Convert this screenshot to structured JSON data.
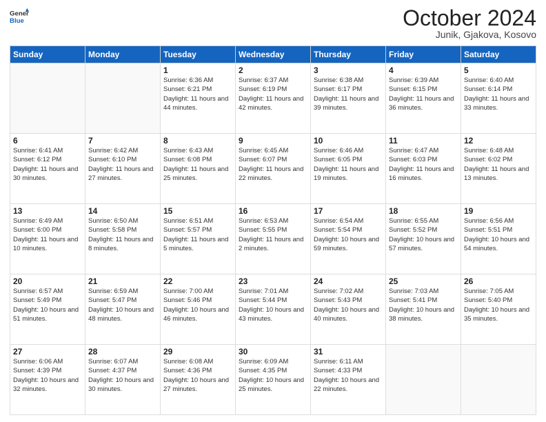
{
  "header": {
    "logo_general": "General",
    "logo_blue": "Blue",
    "title": "October 2024",
    "subtitle": "Junik, Gjakova, Kosovo"
  },
  "days_of_week": [
    "Sunday",
    "Monday",
    "Tuesday",
    "Wednesday",
    "Thursday",
    "Friday",
    "Saturday"
  ],
  "weeks": [
    [
      {
        "day": "",
        "sunrise": "",
        "sunset": "",
        "daylight": ""
      },
      {
        "day": "",
        "sunrise": "",
        "sunset": "",
        "daylight": ""
      },
      {
        "day": "1",
        "sunrise": "Sunrise: 6:36 AM",
        "sunset": "Sunset: 6:21 PM",
        "daylight": "Daylight: 11 hours and 44 minutes."
      },
      {
        "day": "2",
        "sunrise": "Sunrise: 6:37 AM",
        "sunset": "Sunset: 6:19 PM",
        "daylight": "Daylight: 11 hours and 42 minutes."
      },
      {
        "day": "3",
        "sunrise": "Sunrise: 6:38 AM",
        "sunset": "Sunset: 6:17 PM",
        "daylight": "Daylight: 11 hours and 39 minutes."
      },
      {
        "day": "4",
        "sunrise": "Sunrise: 6:39 AM",
        "sunset": "Sunset: 6:15 PM",
        "daylight": "Daylight: 11 hours and 36 minutes."
      },
      {
        "day": "5",
        "sunrise": "Sunrise: 6:40 AM",
        "sunset": "Sunset: 6:14 PM",
        "daylight": "Daylight: 11 hours and 33 minutes."
      }
    ],
    [
      {
        "day": "6",
        "sunrise": "Sunrise: 6:41 AM",
        "sunset": "Sunset: 6:12 PM",
        "daylight": "Daylight: 11 hours and 30 minutes."
      },
      {
        "day": "7",
        "sunrise": "Sunrise: 6:42 AM",
        "sunset": "Sunset: 6:10 PM",
        "daylight": "Daylight: 11 hours and 27 minutes."
      },
      {
        "day": "8",
        "sunrise": "Sunrise: 6:43 AM",
        "sunset": "Sunset: 6:08 PM",
        "daylight": "Daylight: 11 hours and 25 minutes."
      },
      {
        "day": "9",
        "sunrise": "Sunrise: 6:45 AM",
        "sunset": "Sunset: 6:07 PM",
        "daylight": "Daylight: 11 hours and 22 minutes."
      },
      {
        "day": "10",
        "sunrise": "Sunrise: 6:46 AM",
        "sunset": "Sunset: 6:05 PM",
        "daylight": "Daylight: 11 hours and 19 minutes."
      },
      {
        "day": "11",
        "sunrise": "Sunrise: 6:47 AM",
        "sunset": "Sunset: 6:03 PM",
        "daylight": "Daylight: 11 hours and 16 minutes."
      },
      {
        "day": "12",
        "sunrise": "Sunrise: 6:48 AM",
        "sunset": "Sunset: 6:02 PM",
        "daylight": "Daylight: 11 hours and 13 minutes."
      }
    ],
    [
      {
        "day": "13",
        "sunrise": "Sunrise: 6:49 AM",
        "sunset": "Sunset: 6:00 PM",
        "daylight": "Daylight: 11 hours and 10 minutes."
      },
      {
        "day": "14",
        "sunrise": "Sunrise: 6:50 AM",
        "sunset": "Sunset: 5:58 PM",
        "daylight": "Daylight: 11 hours and 8 minutes."
      },
      {
        "day": "15",
        "sunrise": "Sunrise: 6:51 AM",
        "sunset": "Sunset: 5:57 PM",
        "daylight": "Daylight: 11 hours and 5 minutes."
      },
      {
        "day": "16",
        "sunrise": "Sunrise: 6:53 AM",
        "sunset": "Sunset: 5:55 PM",
        "daylight": "Daylight: 11 hours and 2 minutes."
      },
      {
        "day": "17",
        "sunrise": "Sunrise: 6:54 AM",
        "sunset": "Sunset: 5:54 PM",
        "daylight": "Daylight: 10 hours and 59 minutes."
      },
      {
        "day": "18",
        "sunrise": "Sunrise: 6:55 AM",
        "sunset": "Sunset: 5:52 PM",
        "daylight": "Daylight: 10 hours and 57 minutes."
      },
      {
        "day": "19",
        "sunrise": "Sunrise: 6:56 AM",
        "sunset": "Sunset: 5:51 PM",
        "daylight": "Daylight: 10 hours and 54 minutes."
      }
    ],
    [
      {
        "day": "20",
        "sunrise": "Sunrise: 6:57 AM",
        "sunset": "Sunset: 5:49 PM",
        "daylight": "Daylight: 10 hours and 51 minutes."
      },
      {
        "day": "21",
        "sunrise": "Sunrise: 6:59 AM",
        "sunset": "Sunset: 5:47 PM",
        "daylight": "Daylight: 10 hours and 48 minutes."
      },
      {
        "day": "22",
        "sunrise": "Sunrise: 7:00 AM",
        "sunset": "Sunset: 5:46 PM",
        "daylight": "Daylight: 10 hours and 46 minutes."
      },
      {
        "day": "23",
        "sunrise": "Sunrise: 7:01 AM",
        "sunset": "Sunset: 5:44 PM",
        "daylight": "Daylight: 10 hours and 43 minutes."
      },
      {
        "day": "24",
        "sunrise": "Sunrise: 7:02 AM",
        "sunset": "Sunset: 5:43 PM",
        "daylight": "Daylight: 10 hours and 40 minutes."
      },
      {
        "day": "25",
        "sunrise": "Sunrise: 7:03 AM",
        "sunset": "Sunset: 5:41 PM",
        "daylight": "Daylight: 10 hours and 38 minutes."
      },
      {
        "day": "26",
        "sunrise": "Sunrise: 7:05 AM",
        "sunset": "Sunset: 5:40 PM",
        "daylight": "Daylight: 10 hours and 35 minutes."
      }
    ],
    [
      {
        "day": "27",
        "sunrise": "Sunrise: 6:06 AM",
        "sunset": "Sunset: 4:39 PM",
        "daylight": "Daylight: 10 hours and 32 minutes."
      },
      {
        "day": "28",
        "sunrise": "Sunrise: 6:07 AM",
        "sunset": "Sunset: 4:37 PM",
        "daylight": "Daylight: 10 hours and 30 minutes."
      },
      {
        "day": "29",
        "sunrise": "Sunrise: 6:08 AM",
        "sunset": "Sunset: 4:36 PM",
        "daylight": "Daylight: 10 hours and 27 minutes."
      },
      {
        "day": "30",
        "sunrise": "Sunrise: 6:09 AM",
        "sunset": "Sunset: 4:35 PM",
        "daylight": "Daylight: 10 hours and 25 minutes."
      },
      {
        "day": "31",
        "sunrise": "Sunrise: 6:11 AM",
        "sunset": "Sunset: 4:33 PM",
        "daylight": "Daylight: 10 hours and 22 minutes."
      },
      {
        "day": "",
        "sunrise": "",
        "sunset": "",
        "daylight": ""
      },
      {
        "day": "",
        "sunrise": "",
        "sunset": "",
        "daylight": ""
      }
    ]
  ]
}
